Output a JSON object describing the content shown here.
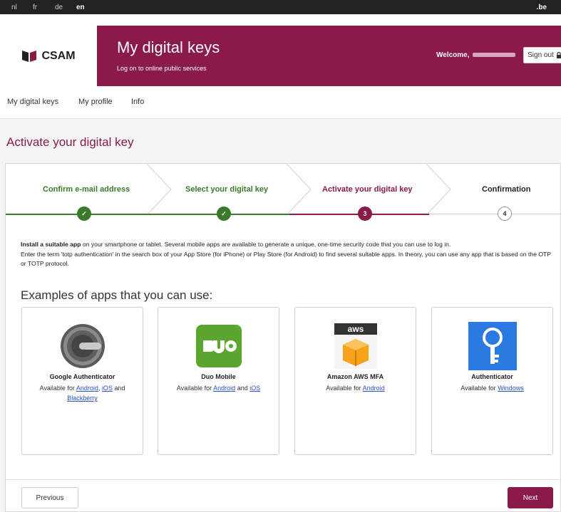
{
  "languages": [
    {
      "code": "nl",
      "active": false
    },
    {
      "code": "fr",
      "active": false
    },
    {
      "code": "de",
      "active": false
    },
    {
      "code": "en",
      "active": true
    }
  ],
  "domain_label": ".be",
  "logo_text": "CSAM",
  "header": {
    "title": "My digital keys",
    "subtitle": "Log on to online public services",
    "welcome_label": "Welcome,",
    "signout_label": "Sign out"
  },
  "nav": {
    "items": [
      "My digital keys",
      "My profile",
      "Info"
    ]
  },
  "page_title": "Activate your digital key",
  "steps": [
    {
      "label": "Confirm e-mail address",
      "state": "done",
      "marker": "✓"
    },
    {
      "label": "Select your digital key",
      "state": "done",
      "marker": "✓"
    },
    {
      "label": "Activate your digital key",
      "state": "active",
      "marker": "3"
    },
    {
      "label": "Confirmation",
      "state": "pending",
      "marker": "4"
    }
  ],
  "intro": {
    "bold_lead": "Install a suitable app",
    "line1_rest": " on your smartphone or tablet. Several mobile apps are available to generate a unique, one-time security code that you can use to log in.",
    "line2": "Enter the term 'totp authentication' in the search box of your App Store (for iPhone) or Play Store (for Android) to find several suitable apps. In theory, you can use any app that is based on the OTP or TOTP protocol."
  },
  "examples_title": "Examples of apps that you can use:",
  "apps": [
    {
      "name": "Google Authenticator",
      "available_prefix": "Available for",
      "icon": "google-authenticator-icon",
      "links": [
        "Android",
        "iOS",
        "Blackberry"
      ]
    },
    {
      "name": "Duo Mobile",
      "available_prefix": "Available for",
      "icon": "duo-mobile-icon",
      "links": [
        "Android",
        "iOS"
      ]
    },
    {
      "name": "Amazon AWS MFA",
      "available_prefix": "Available for",
      "icon": "aws-icon",
      "links": [
        "Android"
      ]
    },
    {
      "name": "Authenticator",
      "available_prefix": "Available for",
      "icon": "key-icon",
      "links": [
        "Windows"
      ]
    }
  ],
  "connectors": {
    "comma": ",",
    "and": "and"
  },
  "buttons": {
    "previous": "Previous",
    "next": "Next"
  },
  "colors": {
    "brand": "#8a1a4a",
    "done": "#3a7a2a",
    "link": "#2a52be"
  }
}
